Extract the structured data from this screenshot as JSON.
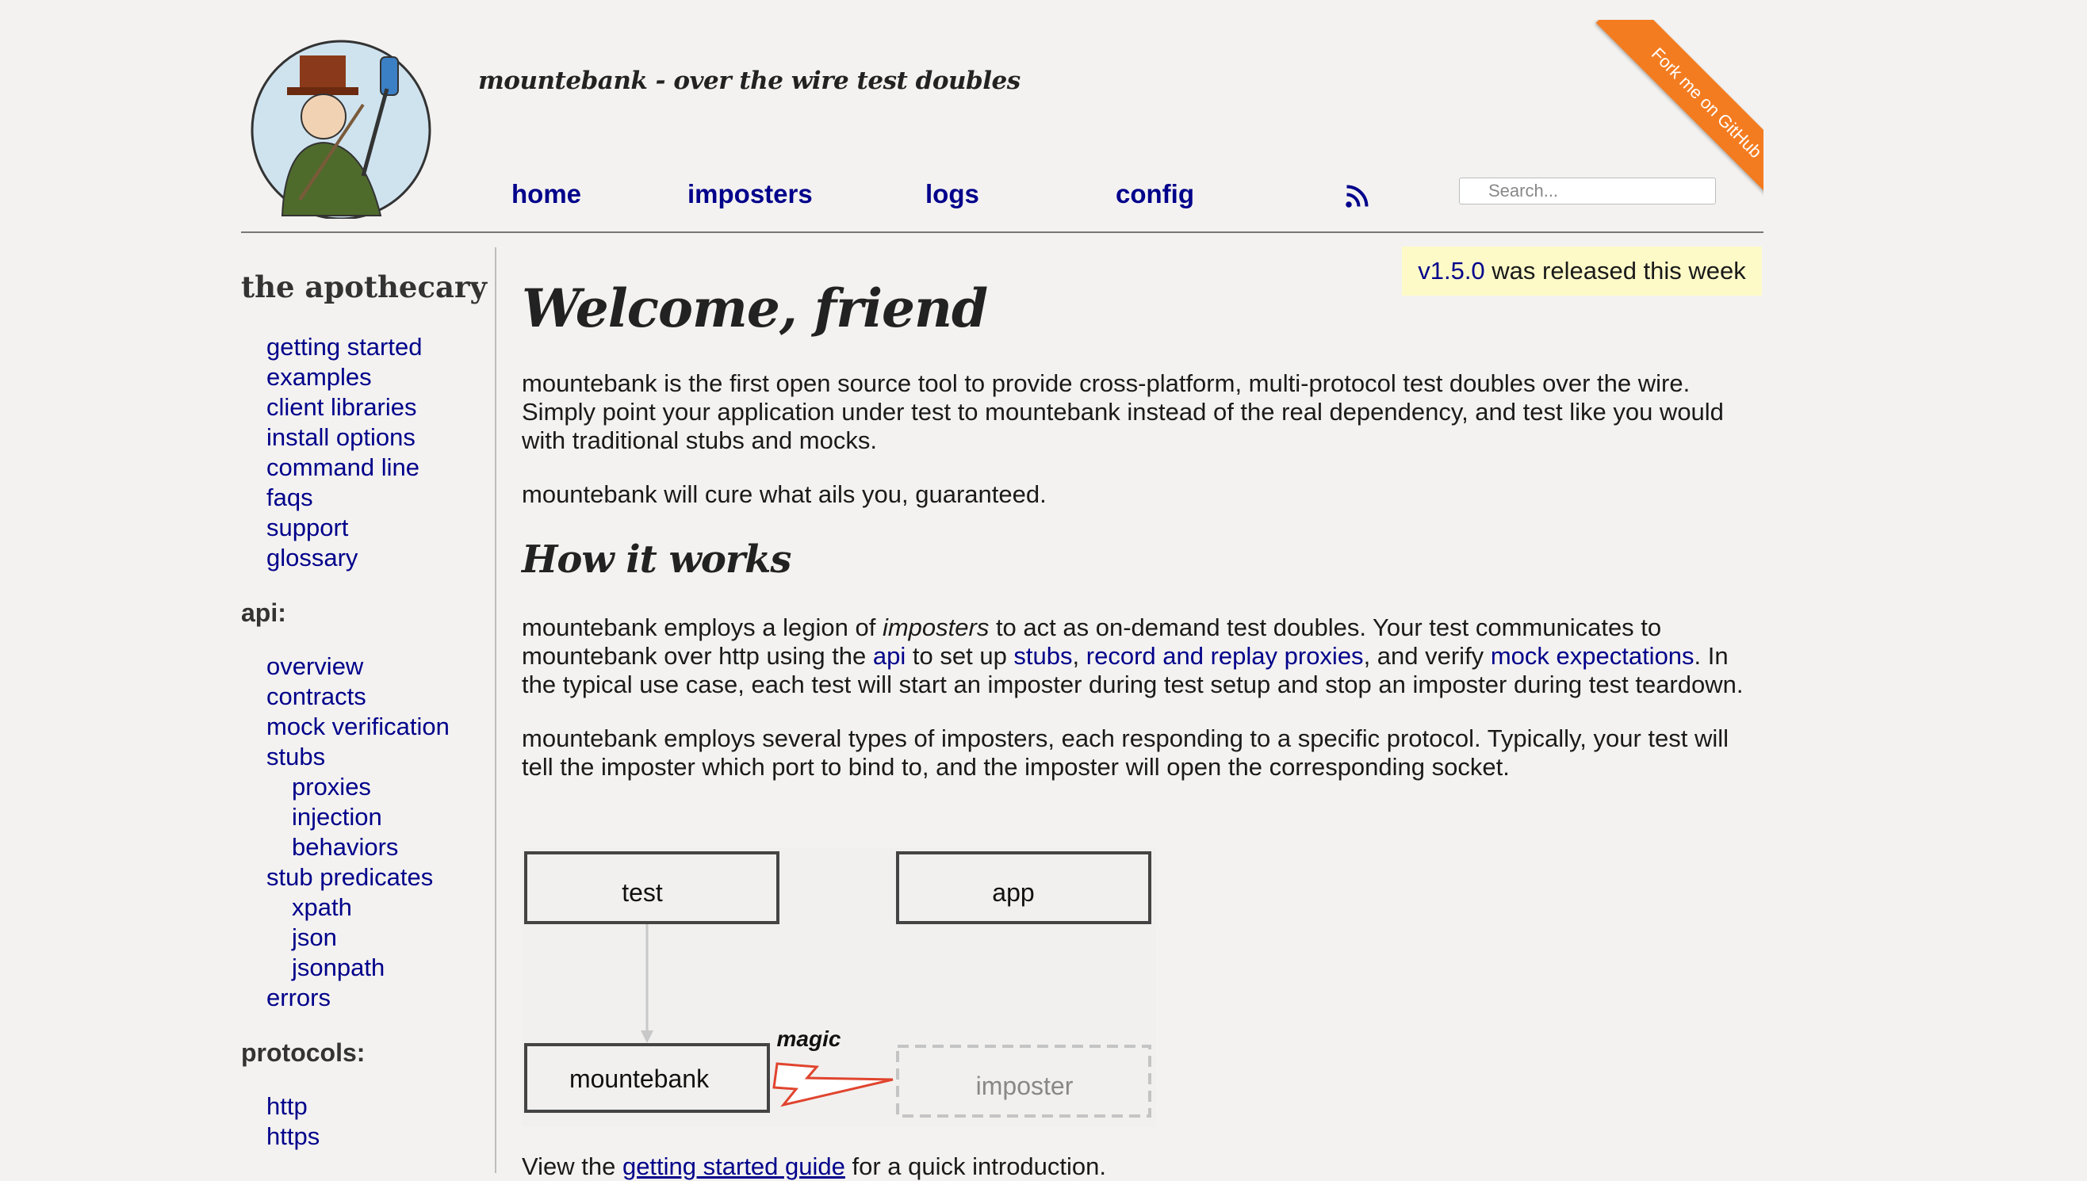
{
  "header": {
    "tagline": "mountebank - over the wire test doubles",
    "nav": [
      {
        "label": "home"
      },
      {
        "label": "imposters"
      },
      {
        "label": "logs"
      },
      {
        "label": "config"
      }
    ],
    "search_placeholder": "Search...",
    "ribbon": "Fork me on GitHub"
  },
  "notice": {
    "version_link": "v1.5.0",
    "rest": " was released this week"
  },
  "sidebar": {
    "heading": "the apothecary",
    "general_links": [
      "getting started",
      "examples",
      "client libraries",
      "install options",
      "command line",
      "faqs",
      "support",
      "glossary"
    ],
    "api_title": "api:",
    "api_links": [
      {
        "label": "overview",
        "level": 1
      },
      {
        "label": "contracts",
        "level": 1
      },
      {
        "label": "mock verification",
        "level": 1
      },
      {
        "label": "stubs",
        "level": 1
      },
      {
        "label": "proxies",
        "level": 2
      },
      {
        "label": "injection",
        "level": 2
      },
      {
        "label": "behaviors",
        "level": 2
      },
      {
        "label": "stub predicates",
        "level": 1
      },
      {
        "label": "xpath",
        "level": 2
      },
      {
        "label": "json",
        "level": 2
      },
      {
        "label": "jsonpath",
        "level": 2
      },
      {
        "label": "errors",
        "level": 1
      }
    ],
    "protocols_title": "protocols:",
    "protocol_links": [
      "http",
      "https"
    ]
  },
  "main": {
    "title": "Welcome, friend",
    "intro": "mountebank is the first open source tool to provide cross-platform, multi-protocol test doubles over the wire. Simply point your application under test to mountebank instead of the real dependency, and test like you would with traditional stubs and mocks.",
    "cure": "mountebank will cure what ails you, guaranteed.",
    "how_title": "How it works",
    "how_p1": {
      "a": "mountebank employs a legion of ",
      "imposters": "imposters",
      "b": " to act as on-demand test doubles. Your test communicates to mountebank over http using the ",
      "api": "api",
      "c": " to set up ",
      "stubs": "stubs",
      "d": ", ",
      "proxies": "record and replay proxies",
      "e": ", and verify ",
      "mock": "mock expectations",
      "f": ". In the typical use case, each test will start an imposter during test setup and stop an imposter during test teardown."
    },
    "how_p2": "mountebank employs several types of imposters, each responding to a specific protocol. Typically, your test will tell the imposter which port to bind to, and the imposter will open the corresponding socket.",
    "diagram": {
      "test": "test",
      "app": "app",
      "mountebank": "mountebank",
      "imposter": "imposter",
      "magic": "magic"
    },
    "footer": {
      "a": "View the ",
      "link": "getting started guide",
      "b": " for a quick introduction."
    }
  }
}
